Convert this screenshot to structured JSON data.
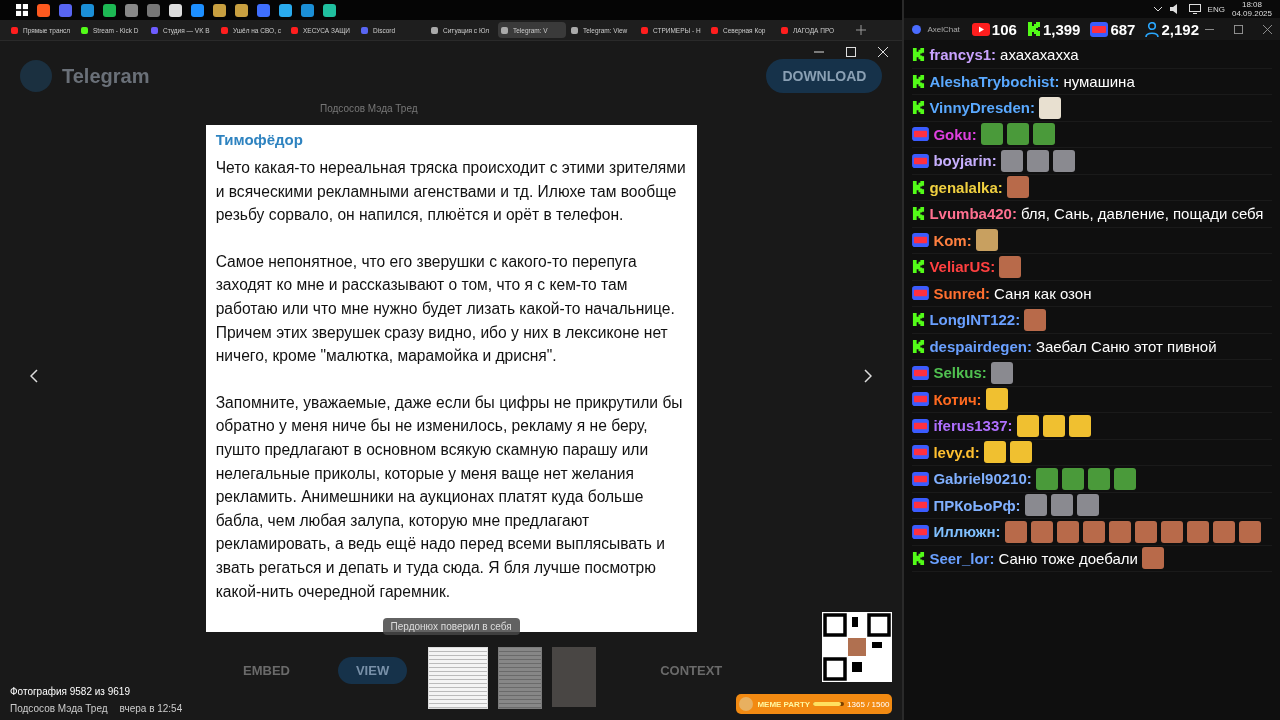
{
  "browser_tabs": [
    {
      "label": "Прямые трансл",
      "color": "#ff1e1e",
      "selected": false
    },
    {
      "label": "Stream - Kick D",
      "color": "#53fc18",
      "selected": false
    },
    {
      "label": "Студия — VK В",
      "color": "#6d5cff",
      "selected": false
    },
    {
      "label": "Ушёл на СВО, с",
      "color": "#ff1e1e",
      "selected": false
    },
    {
      "label": "ХЕСУСА ЗАЩИ",
      "color": "#ff1e1e",
      "selected": false
    },
    {
      "label": "Discord",
      "color": "#5865f2",
      "selected": false
    },
    {
      "label": "Ситуация с Юл",
      "color": "#aaaaaa",
      "selected": false
    },
    {
      "label": "Telegram: V",
      "color": "#aaaaaa",
      "selected": true
    },
    {
      "label": "Telegram: View",
      "color": "#aaaaaa",
      "selected": false
    },
    {
      "label": "СТРИМЕРЫ - Н",
      "color": "#ff1e1e",
      "selected": false
    },
    {
      "label": "Северная Кор",
      "color": "#ff1e1e",
      "selected": false
    },
    {
      "label": "ЛАГОДА ПРО",
      "color": "#ff1e1e",
      "selected": false
    }
  ],
  "tray": {
    "language": "ENG",
    "time": "18:08",
    "date": "04.09.2025"
  },
  "telegram_page": {
    "logo": "Telegram",
    "download": "DOWNLOAD",
    "channel": "Подсосов Мэда Тред",
    "buttons": [
      "EMBED",
      "VIEW",
      "CONTEXT"
    ]
  },
  "viewer": {
    "author": "Тимофёдор",
    "paragraphs": [
      "Чето какая-то нереальная тряска происходит с этими зрителями и всяческими рекламными агенствами и тд. Илюхе там вообще резьбу сорвало, он напился, плюётся и орёт в телефон.",
      "Самое непонятное, что его зверушки с какого-то перепуга заходят ко мне и рассказывают о том, что я с кем-то там работаю или что мне нужно будет лизать какой-то начальнице. Причем этих зверушек сразу видно, ибо у них в лексиконе нет ничего, кроме \"малютка, марамойка и дрисня\".",
      "Запомните, уважаемые, даже если бы цифры не прикрутили бы обратно у меня ниче бы не изменилось, рекламу я не беру, пушто предлагают в основном всякую скамную парашу или нелегальные приколы, которые у меня ваще нет желания рекламить. Анимешники на аукционах платят куда больше бабла, чем любая залупа, которую мне предлагают рекламировать, а ведь ещё надо перед всеми выплясывать и звать регаться и депать и туда сюда. Я бля лучше посмотрю какой-нить очередной гаремник."
    ],
    "caption": "Пердонюх поверил в себя",
    "counter": "Фотография 9582 из 9619",
    "channel": "Подсосов Мэда Тред",
    "date": "вчера в 12:54",
    "thumbnails": [
      {
        "kind": "document",
        "selected": true
      },
      {
        "kind": "document",
        "selected": false
      },
      {
        "kind": "photo",
        "selected": false
      }
    ]
  },
  "meme_party": {
    "title": "MEME PARTY",
    "progress": "1365 / 1500",
    "level": 0.91
  },
  "chat": {
    "title": "AxelChat",
    "counters": [
      {
        "kind": "youtube",
        "value": "106"
      },
      {
        "kind": "kick",
        "value": "1,399"
      },
      {
        "kind": "live",
        "value": "687"
      },
      {
        "kind": "viewers",
        "value": "2,192"
      }
    ],
    "messages": [
      {
        "kind": "kick",
        "name": "francys1:",
        "color": "#c9a2ff",
        "text": "ахахахахха"
      },
      {
        "kind": "kick",
        "name": "AleshaTrybochist:",
        "color": "#5aa9ff",
        "text": "нумашина"
      },
      {
        "kind": "kick",
        "name": "VinnyDresden:",
        "color": "#5aa9ff",
        "emotes": [
          {
            "kind": "cat"
          }
        ]
      },
      {
        "kind": "live",
        "name": "Goku:",
        "color": "#e040e0",
        "emotes": [
          {
            "kind": "frog"
          },
          {
            "kind": "frog"
          },
          {
            "kind": "frog"
          }
        ]
      },
      {
        "kind": "live",
        "name": "boyjarin:",
        "color": "#c8b0ff",
        "emotes": [
          {
            "kind": "gray"
          },
          {
            "kind": "gray"
          },
          {
            "kind": "gray"
          }
        ]
      },
      {
        "kind": "kick",
        "name": "genalalka:",
        "color": "#f0d040",
        "emotes": [
          {
            "kind": "face"
          }
        ]
      },
      {
        "kind": "kick",
        "name": "Lvumba420:",
        "color": "#ff7090",
        "text": "бля, Сань, давление, пощади себя"
      },
      {
        "kind": "live",
        "name": "Kom:",
        "color": "#ff8040",
        "emotes": [
          {
            "kind": "sticker"
          }
        ]
      },
      {
        "kind": "kick",
        "name": "VeliarUS:",
        "color": "#ff4040",
        "emotes": [
          {
            "kind": "face"
          }
        ]
      },
      {
        "kind": "live",
        "name": "Sunred:",
        "color": "#ff7030",
        "text": "Саня как озон"
      },
      {
        "kind": "kick",
        "name": "LongINT122:",
        "color": "#6aa0ff",
        "emotes": [
          {
            "kind": "face"
          }
        ]
      },
      {
        "kind": "kick",
        "name": "despairdegen:",
        "color": "#6aa0ff",
        "text": "Заебал Саню этот пивной"
      },
      {
        "kind": "live",
        "name": "Selkus:",
        "color": "#50c050",
        "emotes": [
          {
            "kind": "gray"
          }
        ]
      },
      {
        "kind": "live",
        "name": "Котич:",
        "color": "#ff6a20",
        "emotes": [
          {
            "kind": "smile"
          }
        ]
      },
      {
        "kind": "live",
        "name": "iferus1337:",
        "color": "#b070ff",
        "emotes": [
          {
            "kind": "smile"
          },
          {
            "kind": "smile"
          },
          {
            "kind": "smile"
          }
        ]
      },
      {
        "kind": "live",
        "name": "levy.d:",
        "color": "#ffc030",
        "emotes": [
          {
            "kind": "smile"
          },
          {
            "kind": "smile"
          }
        ]
      },
      {
        "kind": "live",
        "name": "Gabriel90210:",
        "color": "#80b0ff",
        "emotes": [
          {
            "kind": "frog"
          },
          {
            "kind": "frog"
          },
          {
            "kind": "frog"
          },
          {
            "kind": "frog"
          }
        ]
      },
      {
        "kind": "live",
        "name": "ПРКоЬоРф:",
        "color": "#80b0ff",
        "emotes": [
          {
            "kind": "gray"
          },
          {
            "kind": "gray"
          },
          {
            "kind": "gray"
          }
        ]
      },
      {
        "kind": "live",
        "name": "Иллюжн:",
        "color": "#80c0ff",
        "emotes": [
          {
            "kind": "face"
          },
          {
            "kind": "face"
          },
          {
            "kind": "face"
          },
          {
            "kind": "face"
          },
          {
            "kind": "face"
          },
          {
            "kind": "face"
          },
          {
            "kind": "face"
          },
          {
            "kind": "face"
          },
          {
            "kind": "face"
          },
          {
            "kind": "face"
          }
        ]
      },
      {
        "kind": "kick",
        "name": "Seer_lor:",
        "color": "#6aa0ff",
        "text": "Саню тоже доебали",
        "emotes": [
          {
            "kind": "face"
          }
        ]
      }
    ]
  }
}
